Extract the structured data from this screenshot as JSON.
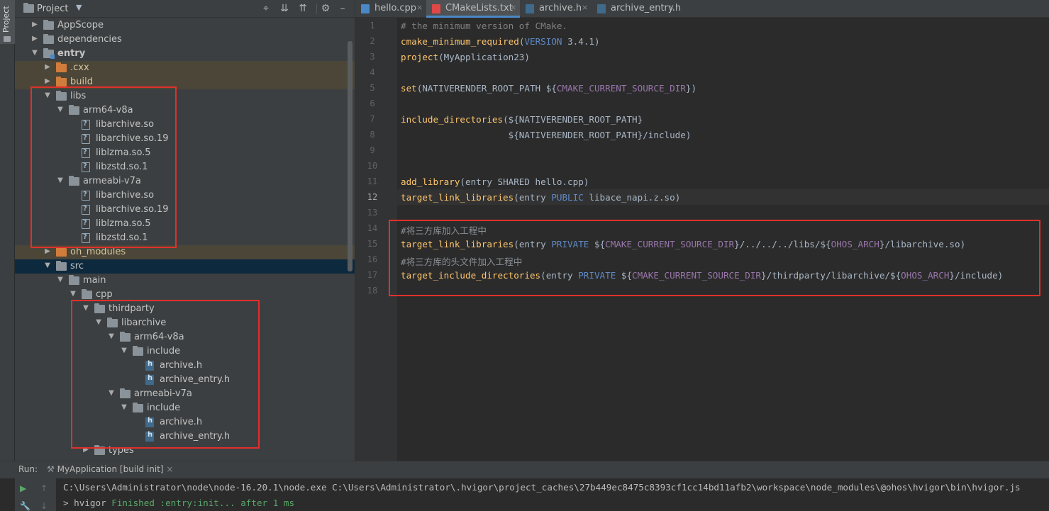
{
  "project_panel": {
    "title": "Project",
    "side_label": "Project",
    "tree": [
      {
        "label": "AppScope",
        "level": 1,
        "arrow": "right",
        "icon": "folder",
        "style": "normal",
        "name": "tree-appscope"
      },
      {
        "label": "dependencies",
        "level": 1,
        "arrow": "right",
        "icon": "folder",
        "style": "normal",
        "name": "tree-dependencies"
      },
      {
        "label": "entry",
        "level": 1,
        "arrow": "down",
        "icon": "module",
        "style": "bold",
        "name": "tree-entry"
      },
      {
        "label": ".cxx",
        "level": 2,
        "arrow": "right",
        "icon": "folder-orange",
        "style": "excluded",
        "name": "tree-cxx"
      },
      {
        "label": "build",
        "level": 2,
        "arrow": "right",
        "icon": "folder-orange",
        "style": "excluded",
        "name": "tree-build"
      },
      {
        "label": "libs",
        "level": 2,
        "arrow": "down",
        "icon": "folder",
        "style": "normal",
        "name": "tree-libs"
      },
      {
        "label": "arm64-v8a",
        "level": 3,
        "arrow": "down",
        "icon": "folder",
        "style": "normal",
        "name": "tree-libs-arm64"
      },
      {
        "label": "libarchive.so",
        "level": 4,
        "arrow": "",
        "icon": "file",
        "style": "normal",
        "name": "tree-file"
      },
      {
        "label": "libarchive.so.19",
        "level": 4,
        "arrow": "",
        "icon": "file",
        "style": "normal",
        "name": "tree-file"
      },
      {
        "label": "liblzma.so.5",
        "level": 4,
        "arrow": "",
        "icon": "file",
        "style": "normal",
        "name": "tree-file"
      },
      {
        "label": "libzstd.so.1",
        "level": 4,
        "arrow": "",
        "icon": "file",
        "style": "normal",
        "name": "tree-file"
      },
      {
        "label": "armeabi-v7a",
        "level": 3,
        "arrow": "down",
        "icon": "folder",
        "style": "normal",
        "name": "tree-libs-armeabi"
      },
      {
        "label": "libarchive.so",
        "level": 4,
        "arrow": "",
        "icon": "file",
        "style": "normal",
        "name": "tree-file"
      },
      {
        "label": "libarchive.so.19",
        "level": 4,
        "arrow": "",
        "icon": "file",
        "style": "normal",
        "name": "tree-file"
      },
      {
        "label": "liblzma.so.5",
        "level": 4,
        "arrow": "",
        "icon": "file",
        "style": "normal",
        "name": "tree-file"
      },
      {
        "label": "libzstd.so.1",
        "level": 4,
        "arrow": "",
        "icon": "file",
        "style": "normal",
        "name": "tree-file"
      },
      {
        "label": "oh_modules",
        "level": 2,
        "arrow": "right",
        "icon": "folder-orange",
        "style": "excluded",
        "name": "tree-oh-modules"
      },
      {
        "label": "src",
        "level": 2,
        "arrow": "down",
        "icon": "folder",
        "style": "selected",
        "name": "tree-src"
      },
      {
        "label": "main",
        "level": 3,
        "arrow": "down",
        "icon": "folder",
        "style": "normal",
        "name": "tree-main"
      },
      {
        "label": "cpp",
        "level": 4,
        "arrow": "down",
        "icon": "folder",
        "style": "normal",
        "name": "tree-cpp"
      },
      {
        "label": "thirdparty",
        "level": 5,
        "arrow": "down",
        "icon": "folder",
        "style": "normal",
        "name": "tree-thirdparty"
      },
      {
        "label": "libarchive",
        "level": 6,
        "arrow": "down",
        "icon": "folder",
        "style": "normal",
        "name": "tree-libarchive"
      },
      {
        "label": "arm64-v8a",
        "level": 7,
        "arrow": "down",
        "icon": "folder",
        "style": "normal",
        "name": "tree-tp-arm64"
      },
      {
        "label": "include",
        "level": 8,
        "arrow": "down",
        "icon": "folder",
        "style": "normal",
        "name": "tree-include"
      },
      {
        "label": "archive.h",
        "level": 9,
        "arrow": "",
        "icon": "hfile",
        "style": "normal",
        "name": "tree-header-file"
      },
      {
        "label": "archive_entry.h",
        "level": 9,
        "arrow": "",
        "icon": "hfile",
        "style": "normal",
        "name": "tree-header-file"
      },
      {
        "label": "armeabi-v7a",
        "level": 7,
        "arrow": "down",
        "icon": "folder",
        "style": "normal",
        "name": "tree-tp-armeabi"
      },
      {
        "label": "include",
        "level": 8,
        "arrow": "down",
        "icon": "folder",
        "style": "normal",
        "name": "tree-include"
      },
      {
        "label": "archive.h",
        "level": 9,
        "arrow": "",
        "icon": "hfile",
        "style": "normal",
        "name": "tree-header-file"
      },
      {
        "label": "archive_entry.h",
        "level": 9,
        "arrow": "",
        "icon": "hfile",
        "style": "normal",
        "name": "tree-header-file"
      },
      {
        "label": "types",
        "level": 5,
        "arrow": "right",
        "icon": "folder",
        "style": "normal",
        "name": "tree-types"
      }
    ]
  },
  "editor": {
    "tabs": [
      {
        "label": "hello.cpp",
        "icon_color": "#4a88c7",
        "active": false
      },
      {
        "label": "CMakeLists.txt",
        "icon_color": "#e04848",
        "active": true
      },
      {
        "label": "archive.h",
        "icon_color": "#3f6a8c",
        "active": false
      },
      {
        "label": "archive_entry.h",
        "icon_color": "#3f6a8c",
        "active": false
      }
    ],
    "current_line": 12,
    "lines": [
      [
        [
          "# the minimum version of CMake.",
          "cm"
        ]
      ],
      [
        [
          "cmake_minimum_required",
          "fn"
        ],
        [
          "(",
          "tx"
        ],
        [
          "VERSION",
          "bl"
        ],
        [
          " 3.4.1)",
          "tx"
        ]
      ],
      [
        [
          "project",
          "fn"
        ],
        [
          "(MyApplication23)",
          "tx"
        ]
      ],
      [],
      [
        [
          "set",
          "fn"
        ],
        [
          "(NATIVERENDER_ROOT_PATH ${",
          "tx"
        ],
        [
          "CMAKE_CURRENT_SOURCE_DIR",
          "kw"
        ],
        [
          "})",
          "tx"
        ]
      ],
      [],
      [
        [
          "include_directories",
          "fn"
        ],
        [
          "(${NATIVERENDER_ROOT_PATH}",
          "tx"
        ]
      ],
      [
        [
          "                    ${NATIVERENDER_ROOT_PATH}/include)",
          "tx"
        ]
      ],
      [],
      [],
      [
        [
          "add_library",
          "fn"
        ],
        [
          "(entry SHARED hello.cpp)",
          "tx"
        ]
      ],
      [
        [
          "target_link_libraries",
          "fn"
        ],
        [
          "(entry ",
          "tx"
        ],
        [
          "PUBLIC",
          "bl"
        ],
        [
          " libace_napi.z.so)",
          "tx"
        ]
      ],
      [],
      [
        [
          "#将三方库加入工程中",
          "ch"
        ]
      ],
      [
        [
          "target_link_libraries",
          "fn"
        ],
        [
          "(entry ",
          "tx"
        ],
        [
          "PRIVATE",
          "bl"
        ],
        [
          " ${",
          "tx"
        ],
        [
          "CMAKE_CURRENT_SOURCE_DIR",
          "kw"
        ],
        [
          "}/../../../libs/${",
          "tx"
        ],
        [
          "OHOS_ARCH",
          "kw"
        ],
        [
          "}/libarchive.so)",
          "tx"
        ]
      ],
      [
        [
          "#将三方库的头文件加入工程中",
          "ch"
        ]
      ],
      [
        [
          "target_include_directories",
          "fn"
        ],
        [
          "(entry ",
          "tx"
        ],
        [
          "PRIVATE",
          "bl"
        ],
        [
          " ${",
          "tx"
        ],
        [
          "CMAKE_CURRENT_SOURCE_DIR",
          "kw"
        ],
        [
          "}/thirdparty/libarchive/${",
          "tx"
        ],
        [
          "OHOS_ARCH",
          "kw"
        ],
        [
          "}/include)",
          "tx"
        ]
      ],
      []
    ]
  },
  "run_panel": {
    "label": "Run:",
    "tab": "MyApplication [build init]",
    "command_line": "C:\\Users\\Administrator\\node\\node-16.20.1\\node.exe C:\\Users\\Administrator\\.hvigor\\project_caches\\27b449ec8475c8393cf1cc14bd11afb2\\workspace\\node_modules\\@ohos\\hvigor\\bin\\hvigor.js",
    "status_prefix": "> hvigor ",
    "status_text": "Finished :entry:init... after 1 ms"
  },
  "icons": {
    "locate": "crosshair-icon",
    "expand": "expand-all-icon",
    "collapse": "collapse-all-icon",
    "settings": "gear-icon",
    "hide": "minimize-icon",
    "run": "play-icon",
    "build": "hammer-icon"
  },
  "colors": {
    "highlight_box": "#e0302c",
    "selection": "#0d293e",
    "excluded_row": "#4b4638"
  }
}
